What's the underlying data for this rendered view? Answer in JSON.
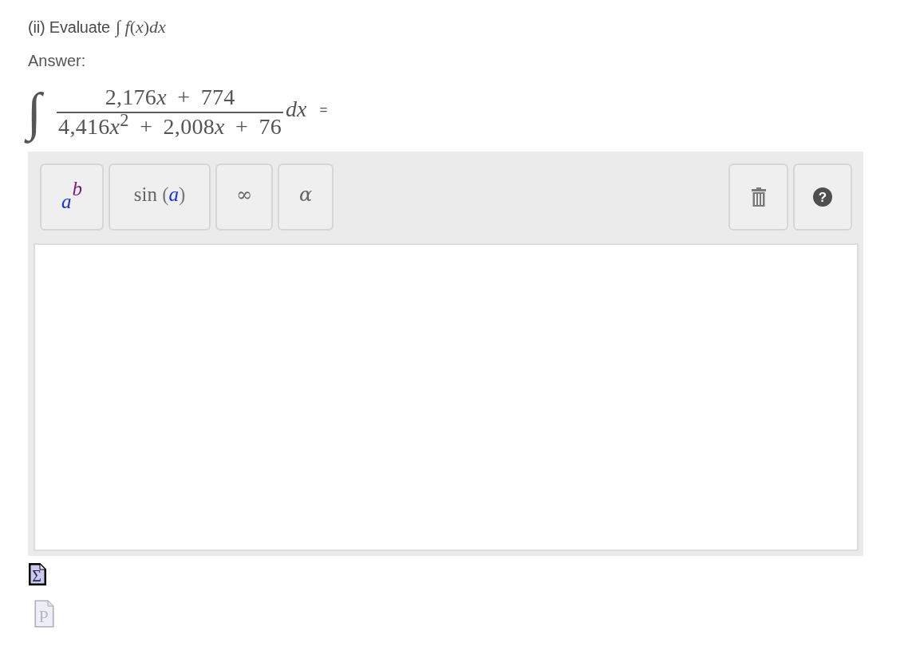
{
  "question": {
    "label": "(ii) Evaluate",
    "formula": "∫ *f*(*x*)*dx*"
  },
  "answer_label": "Answer:",
  "answer_equation": {
    "integral": "∫",
    "numerator": [
      {
        "coefficient": "2,176",
        "variable": "x"
      },
      {
        "sign": "+",
        "coefficient": "774"
      }
    ],
    "denominator": [
      {
        "coefficient": "4,416",
        "variable": "x",
        "power": "2"
      },
      {
        "sign": "+",
        "coefficient": "2,008",
        "variable": "x"
      },
      {
        "sign": "+",
        "coefficient": "76"
      }
    ],
    "differential": "dx",
    "equals": "="
  },
  "toolbar": {
    "tools": [
      {
        "kind": "power",
        "base": "a",
        "exponent": "b"
      },
      {
        "kind": "function",
        "name": "sin",
        "open": "(",
        "argument": "a",
        "close": ")"
      },
      {
        "kind": "symbol",
        "label": "∞"
      },
      {
        "kind": "symbol",
        "label": "α"
      }
    ],
    "actions": [
      {
        "kind": "trash"
      },
      {
        "kind": "help",
        "glyph": "?"
      }
    ]
  },
  "attachments": [
    {
      "kind": "formula",
      "glyph": "Σ",
      "disabled": false
    },
    {
      "kind": "document",
      "glyph": "P",
      "disabled": true
    }
  ]
}
